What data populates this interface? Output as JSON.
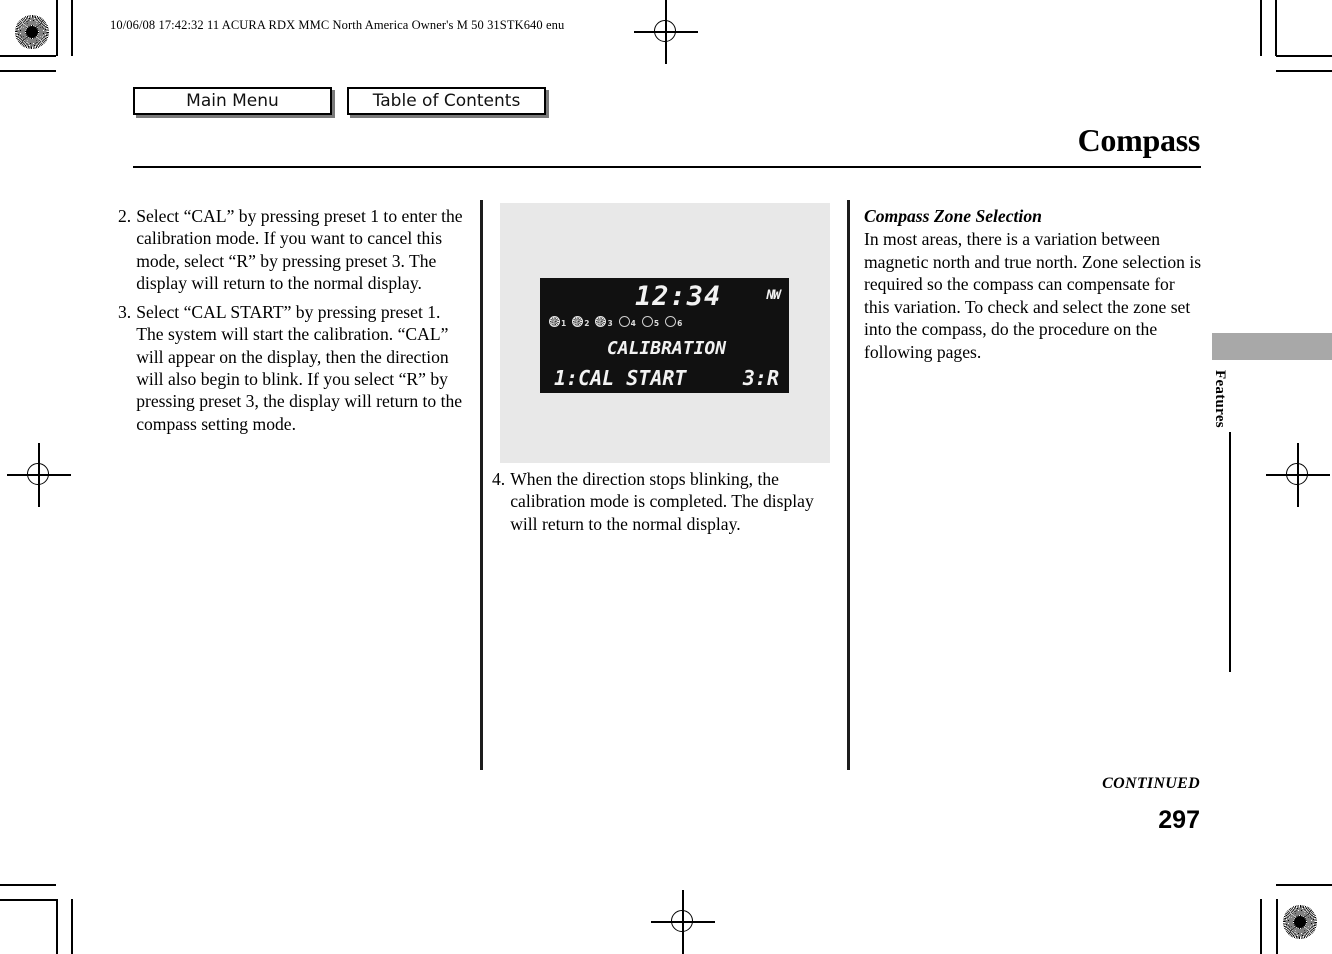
{
  "header": {
    "slug": "10/06/08 17:42:32   11 ACURA RDX MMC North America Owner's M 50 31STK640 enu"
  },
  "nav": {
    "main_menu": "Main Menu",
    "table_of_contents": "Table of Contents"
  },
  "page": {
    "title": "Compass",
    "side_tab": "Features",
    "continued": "CONTINUED",
    "number": "297"
  },
  "column_left": {
    "steps": [
      {
        "num": "2.",
        "text": "Select “CAL” by pressing preset 1 to enter the calibration mode. If you want to cancel this mode, select “R” by pressing preset 3. The display will return to the normal display."
      },
      {
        "num": "3.",
        "text": "Select “CAL START” by pressing preset 1. The system will start the calibration. “CAL” will appear on the display, then the direction will also begin to blink. If you select “R” by pressing preset 3, the display will return to the compass setting mode."
      }
    ]
  },
  "column_center": {
    "lcd": {
      "time": "12:34",
      "direction": "NW",
      "presets": [
        {
          "index": "1",
          "active": true
        },
        {
          "index": "2",
          "active": true
        },
        {
          "index": "3",
          "active": true
        },
        {
          "index": "4",
          "active": false
        },
        {
          "index": "5",
          "active": false
        },
        {
          "index": "6",
          "active": false
        }
      ],
      "line1": "CALIBRATION",
      "line2_left": "1:CAL START",
      "line2_right": "3:R"
    },
    "step": {
      "num": "4.",
      "text": "When the direction stops blinking, the calibration mode is completed. The display will return to the normal display."
    }
  },
  "column_right": {
    "heading": "Compass Zone Selection",
    "body": "In most areas, there is a variation between magnetic north and true north. Zone selection is required so the compass can compensate for this variation. To check and select the zone set into the compass, do the procedure on the following pages."
  },
  "colors": {
    "figure_bg": "#e8e8e8",
    "lcd_bg": "#111111",
    "lcd_text": "#f2f2f2",
    "side_tab": "#a8a8a8"
  }
}
